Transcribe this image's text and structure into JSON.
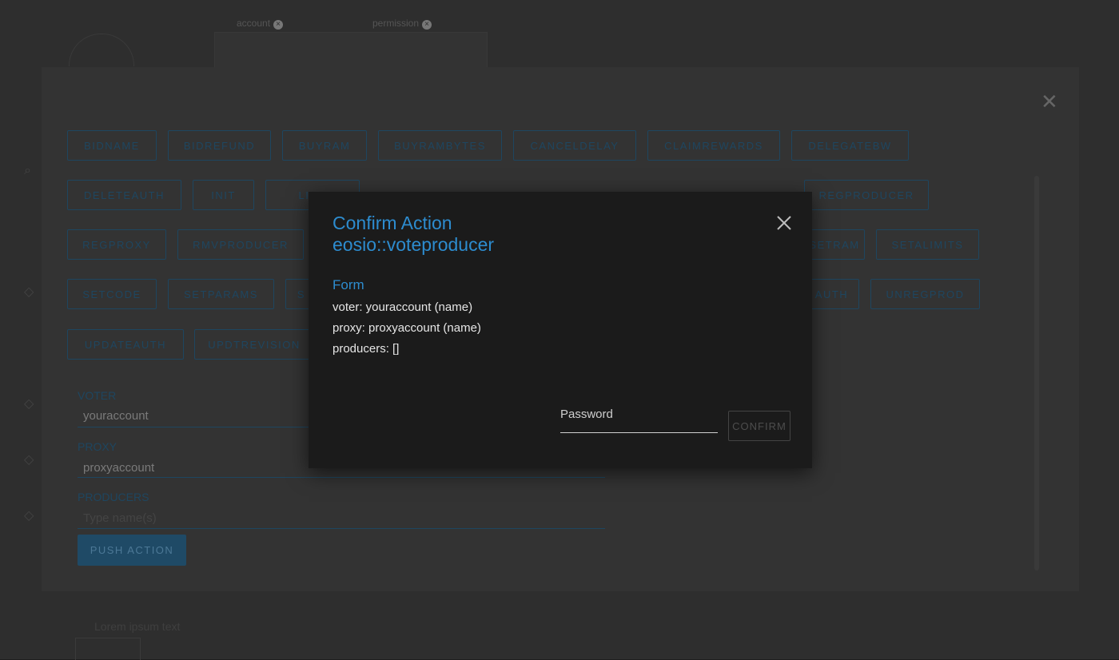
{
  "background": {
    "top_tabs": [
      "account",
      "permission"
    ],
    "action_buttons": [
      "BIDNAME",
      "BIDREFUND",
      "BUYRAM",
      "BUYRAMBYTES",
      "CANCELDELAY",
      "CLAIMREWARDS",
      "DELEGATEBW",
      "DELETEAUTH",
      "INIT",
      "LINK",
      "",
      "",
      "",
      "",
      "REGPRODUCER",
      "REGPROXY",
      "RMVPRODUCER",
      "",
      "",
      "",
      "",
      "SETRAM",
      "SETALIMITS",
      "SETCODE",
      "SETPARAMS",
      "S",
      "",
      "",
      "",
      "AUTH",
      "UNREGPROD",
      "UPDATEAUTH",
      "UPDTREVISION"
    ],
    "fields": [
      {
        "label": "VOTER",
        "value": "youraccount"
      },
      {
        "label": "PROXY",
        "value": "proxyaccount"
      },
      {
        "label": "PRODUCERS",
        "value": "Type name(s)"
      }
    ],
    "push_button": "PUSH ACTION",
    "bottom_text": "Lorem ipsum text"
  },
  "modal": {
    "title_line1": "Confirm Action",
    "title_line2": "eosio::voteproducer",
    "form_title": "Form",
    "lines": [
      "voter: youraccount (name)",
      "proxy: proxyaccount (name)",
      "producers: []"
    ],
    "password_placeholder": "Password",
    "confirm_label": "CONFIRM",
    "close_icon": "close-icon"
  },
  "colors": {
    "accent": "#2d8ccf",
    "modal_bg": "#1b1b1b",
    "backdrop": "#2e2e2e"
  }
}
